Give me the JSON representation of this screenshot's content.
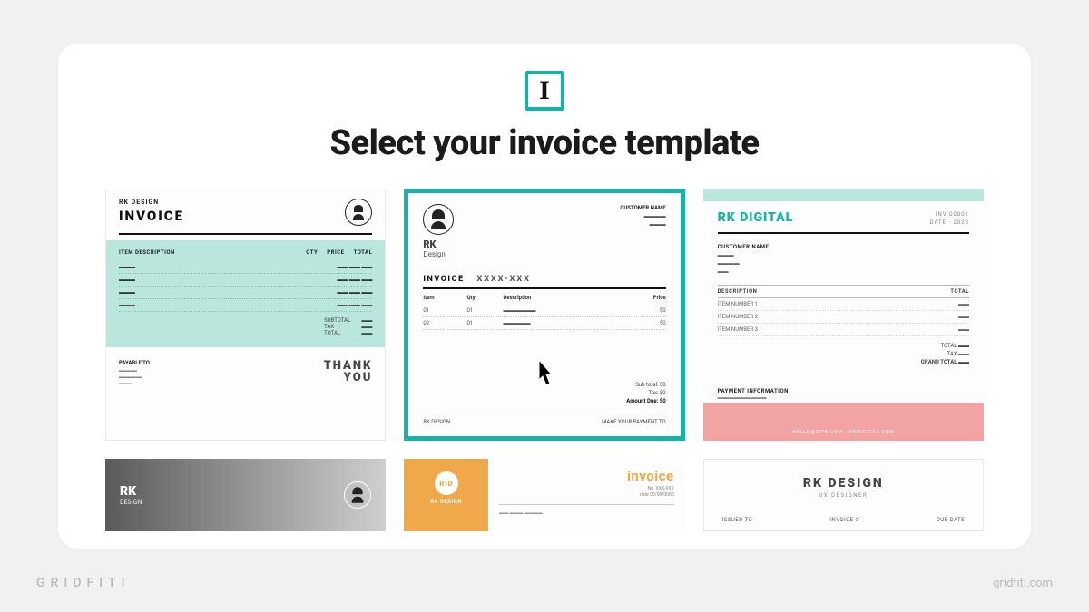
{
  "logo_letter": "I",
  "headline": "Select your invoice template",
  "templates": {
    "t1": {
      "brand": "RK DESIGN",
      "title": "INVOICE",
      "th_desc": "ITEM DESCRIPTION",
      "th_qty": "QTY",
      "th_price": "PRICE",
      "th_total": "TOTAL",
      "subtotal_label": "SUBTOTAL",
      "tax_label": "TAX",
      "total_label": "TOTAL",
      "payable_label": "PAYABLE TO",
      "thank": "THANK",
      "you": "YOU"
    },
    "t2": {
      "brand1": "RK",
      "brand2": "Design",
      "customer_h": "CUSTOMER NAME",
      "invoice_label": "INVOICE",
      "invoice_num": "XXXX-XXX",
      "th_item": "Item",
      "th_qty": "Qty",
      "th_desc": "Description",
      "th_price": "Price",
      "sub_label": "Sub total:",
      "tax_label": "Tax:",
      "due_label": "Amount Due:",
      "sub_val": "$0",
      "tax_val": "$0",
      "due_val": "$0",
      "foot_left": "RK DESIGN",
      "foot_right": "MAKE YOUR PAYMENT TO"
    },
    "t3": {
      "brand": "RK DIGITAL",
      "inv_no": "INV 00001",
      "date": "DATE · 2023",
      "cust_h": "CUSTOMER NAME",
      "th_desc": "DESCRIPTION",
      "th_total": "TOTAL",
      "item_label": "ITEM NUMBER 1",
      "total_label": "TOTAL",
      "grand_label": "GRAND TOTAL",
      "pay_h": "PAYMENT INFORMATION",
      "note": "HELLO@SITE.COM · RKDIGITAL.COM"
    },
    "t4": {
      "brand1": "RK",
      "brand2": "DESIGN"
    },
    "t5": {
      "logo_text": "R•D",
      "name": "RK DESIGN",
      "title": "invoice",
      "meta1": "No. XXX-XXX",
      "meta2": "date 00/00/0000"
    },
    "t6": {
      "brand": "RK DESIGN",
      "sub": "UX DESIGNER",
      "col1": "ISSUED TO",
      "col2": "INVOICE #",
      "col3": "DUE DATE"
    }
  },
  "watermark_left": "GRIDFITI",
  "watermark_right": "gridfiti.com"
}
